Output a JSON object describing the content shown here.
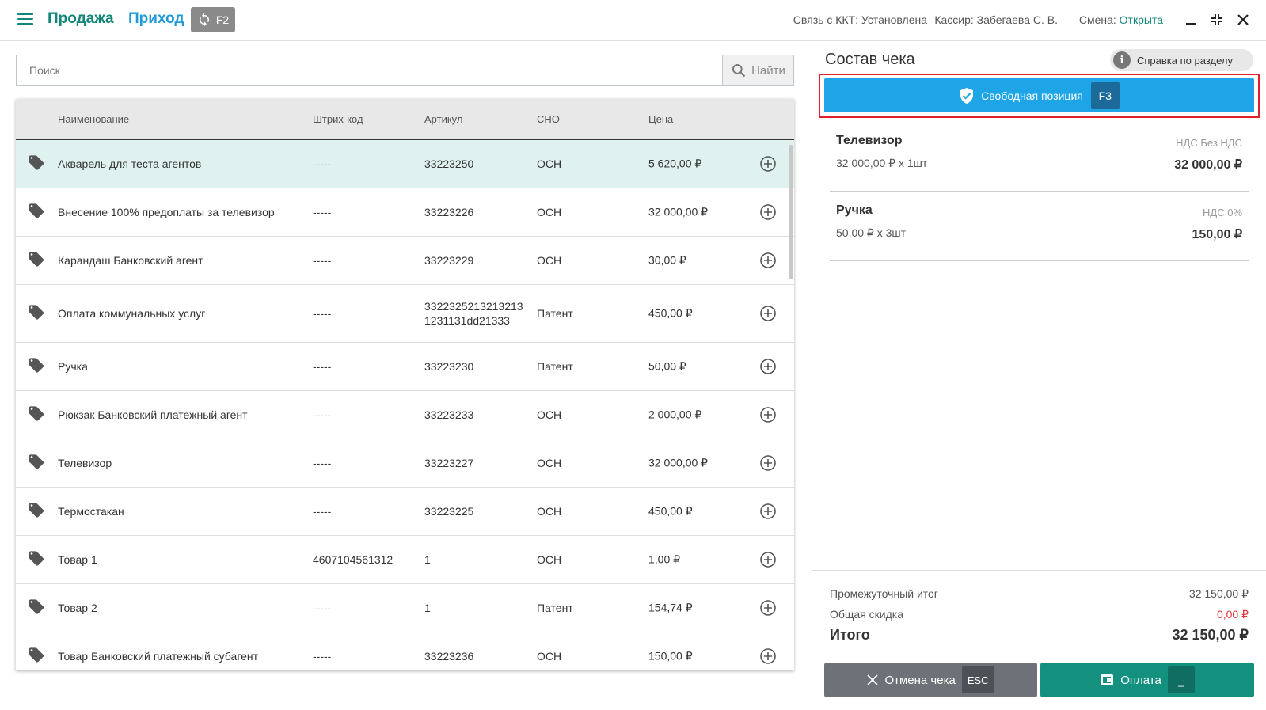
{
  "header": {
    "tab_sale": "Продажа",
    "tab_income": "Приход",
    "refresh_key": "F2",
    "kkt_status": "Связь с ККТ: Установлена",
    "cashier": "Кассир: Забегаева С. В.",
    "shift_label": "Смена: ",
    "shift_value": "Открыта"
  },
  "search": {
    "placeholder": "Поиск",
    "button_label": "Найти"
  },
  "table": {
    "columns": {
      "name": "Наименование",
      "barcode": "Штрих-код",
      "article": "Артикул",
      "sno": "СНО",
      "price": "Цена"
    },
    "rows": [
      {
        "name": "Акварель для теста агентов",
        "barcode": "-----",
        "article": "33223250",
        "sno": "ОСН",
        "price": "5 620,00 ₽"
      },
      {
        "name": "Внесение 100% предоплаты за телевизор",
        "barcode": "-----",
        "article": "33223226",
        "sno": "ОСН",
        "price": "32 000,00 ₽"
      },
      {
        "name": "Карандаш Банковский агент",
        "barcode": "-----",
        "article": "33223229",
        "sno": "ОСН",
        "price": "30,00 ₽"
      },
      {
        "name": "Оплата коммунальных услуг",
        "barcode": "-----",
        "article": "3322325213213213 1231131dd21333",
        "sno": "Патент",
        "price": "450,00 ₽"
      },
      {
        "name": "Ручка",
        "barcode": "-----",
        "article": "33223230",
        "sno": "Патент",
        "price": "50,00 ₽"
      },
      {
        "name": "Рюкзак Банковский платежный агент",
        "barcode": "-----",
        "article": "33223233",
        "sno": "ОСН",
        "price": "2 000,00 ₽"
      },
      {
        "name": "Телевизор",
        "barcode": "-----",
        "article": "33223227",
        "sno": "ОСН",
        "price": "32 000,00 ₽"
      },
      {
        "name": "Термостакан",
        "barcode": "-----",
        "article": "33223225",
        "sno": "ОСН",
        "price": "450,00 ₽"
      },
      {
        "name": "Товар 1",
        "barcode": "4607104561312",
        "article": "1",
        "sno": "ОСН",
        "price": "1,00 ₽"
      },
      {
        "name": "Товар 2",
        "barcode": "-----",
        "article": "1",
        "sno": "Патент",
        "price": "154,74 ₽"
      },
      {
        "name": "Товар Банковский платежный субагент",
        "barcode": "-----",
        "article": "33223236",
        "sno": "ОСН",
        "price": "150,00 ₽"
      }
    ]
  },
  "receipt": {
    "title": "Состав чека",
    "help_label": "Справка по разделу",
    "free_position_label": "Свободная позиция",
    "free_position_key": "F3",
    "items": [
      {
        "name": "Телевизор",
        "qty": "32 000,00 ₽ х 1шт",
        "vat": "НДС Без НДС",
        "sum": "32 000,00 ₽"
      },
      {
        "name": "Ручка",
        "qty": "50,00 ₽ х 3шт",
        "vat": "НДС 0%",
        "sum": "150,00 ₽"
      }
    ],
    "subtotal_label": "Промежуточный итог",
    "subtotal_value": "32 150,00 ₽",
    "discount_label": "Общая скидка",
    "discount_value": "0,00 ₽",
    "total_label": "Итого",
    "total_value": "32 150,00 ₽",
    "cancel_label": "Отмена чека",
    "cancel_key": "ESC",
    "pay_label": "Оплата",
    "pay_key": "_"
  },
  "colors": {
    "brand_green": "#13867a",
    "brand_blue": "#1f9ad6",
    "free_position_blue": "#1ea5e8",
    "discount_red": "#e03838",
    "highlight_frame": "#e0202a"
  }
}
